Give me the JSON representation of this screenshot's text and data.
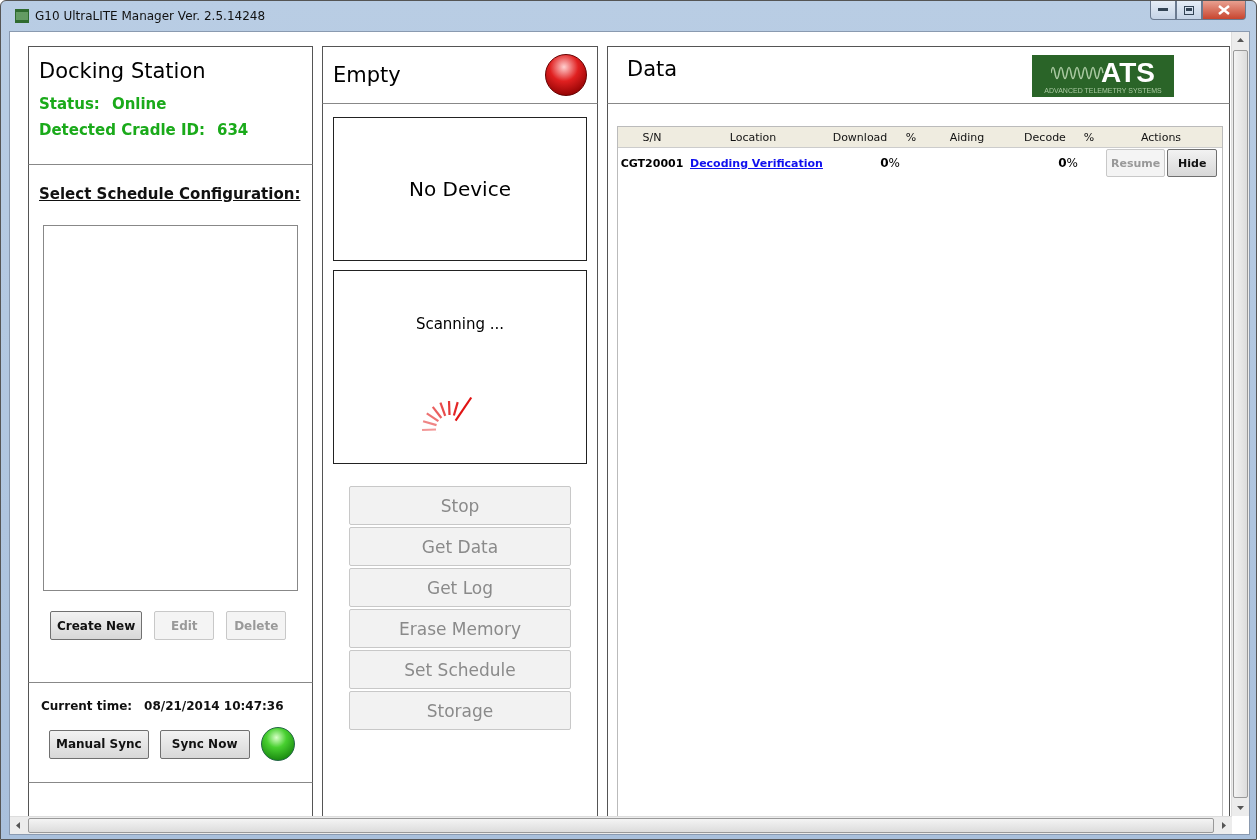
{
  "window": {
    "title": "G10 UltraLITE Manager Ver. 2.5.14248"
  },
  "docking_station": {
    "title": "Docking Station",
    "status_label": "Status:",
    "status": "Online",
    "cradle_label": "Detected Cradle ID:",
    "cradle_id": "634"
  },
  "schedule": {
    "heading": "Select Schedule Configuration:",
    "buttons": [
      {
        "label": "Create New",
        "disabled": false
      },
      {
        "label": "Edit",
        "disabled": true
      },
      {
        "label": "Delete",
        "disabled": true
      }
    ]
  },
  "sync": {
    "time_label": "Current time:",
    "time": "08/21/2014 10:47:36",
    "buttons": [
      {
        "label": "Manual Sync",
        "disabled": false
      },
      {
        "label": "Sync Now",
        "disabled": false
      }
    ],
    "in_sync": true
  },
  "device": {
    "title": "Empty",
    "connected": false,
    "name": "No Device",
    "scan_text": "Scanning ...",
    "buttons": [
      {
        "label": "Stop",
        "disabled": true
      },
      {
        "label": "Get Data",
        "disabled": true
      },
      {
        "label": "Get Log",
        "disabled": true
      },
      {
        "label": "Erase Memory",
        "disabled": true
      },
      {
        "label": "Set Schedule",
        "disabled": true
      },
      {
        "label": "Storage",
        "disabled": true
      }
    ]
  },
  "data": {
    "title": "Data",
    "logo": {
      "text": "ATS",
      "tagline": "ADVANCED TELEMETRY SYSTEMS"
    },
    "table": {
      "columns": [
        "S/N",
        "Location",
        "Download",
        "%",
        "Aiding",
        "Decode",
        "%",
        "Actions"
      ],
      "rows": [
        {
          "sn": "CGT20001",
          "location": "Decoding Verification",
          "download": "0",
          "download_unit": "%",
          "decode": "0",
          "decode_unit": "%",
          "actions": [
            {
              "label": "Resume",
              "disabled": true
            },
            {
              "label": "Hide",
              "disabled": false
            }
          ]
        }
      ]
    }
  }
}
